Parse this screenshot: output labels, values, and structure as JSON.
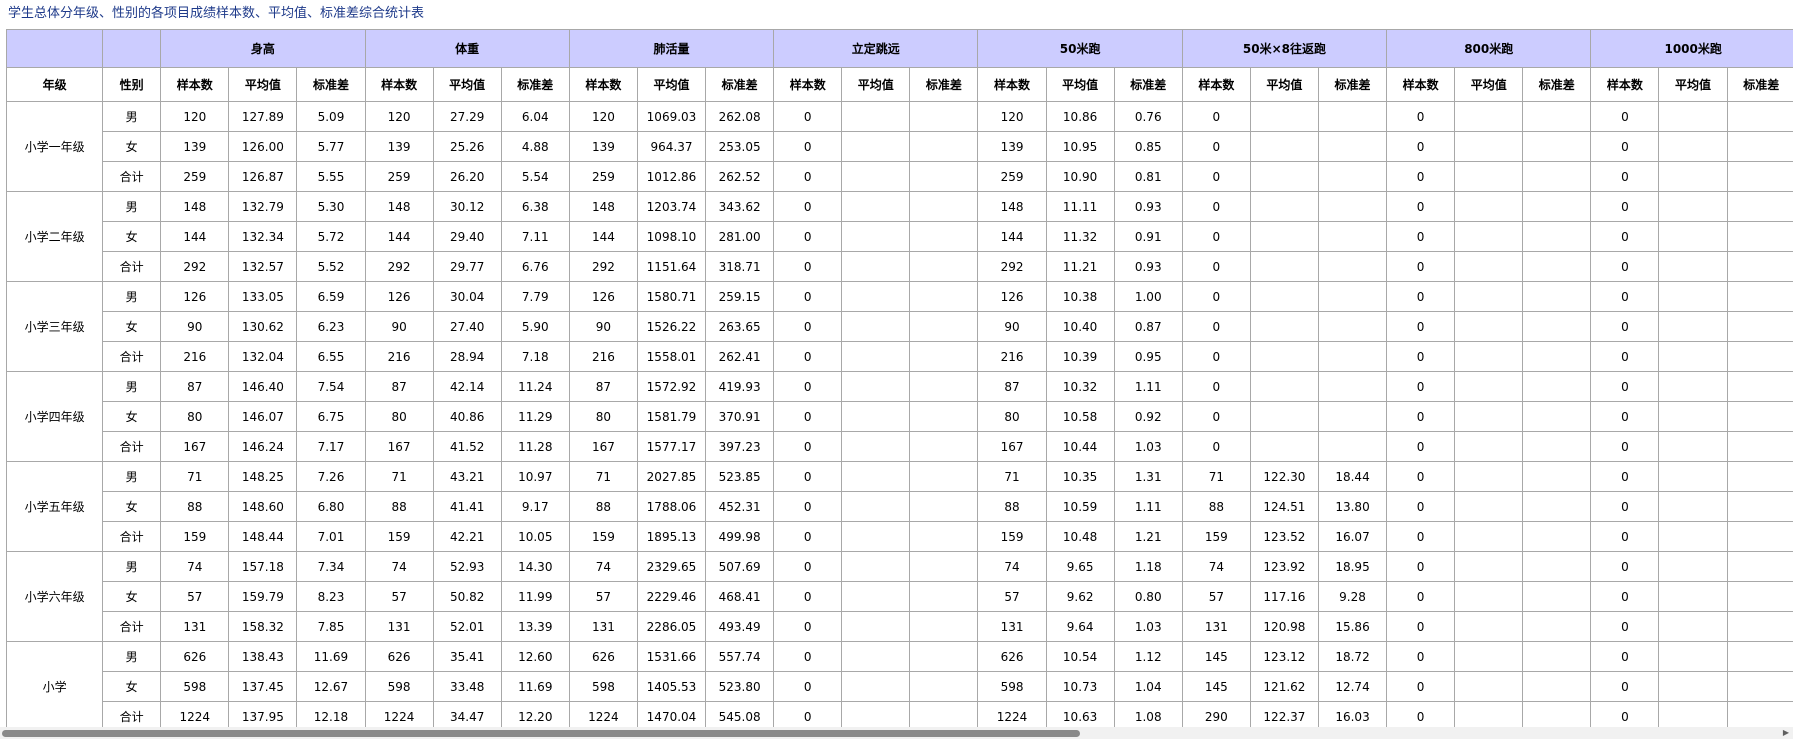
{
  "title": "学生总体分年级、性别的各项目成绩样本数、平均值、标准差综合统计表",
  "headers": {
    "grade": "年级",
    "gender": "性别",
    "sub": [
      "样本数",
      "平均值",
      "标准差"
    ],
    "items": [
      "身高",
      "体重",
      "肺活量",
      "立定跳远",
      "50米跑",
      "50米×8往返跑",
      "800米跑",
      "1000米跑"
    ]
  },
  "rows": [
    {
      "grade": "小学一年级",
      "gender": "男",
      "cells": [
        "120",
        "127.89",
        "5.09",
        "120",
        "27.29",
        "6.04",
        "120",
        "1069.03",
        "262.08",
        "0",
        "",
        "",
        "120",
        "10.86",
        "0.76",
        "0",
        "",
        "",
        "0",
        "",
        "",
        "0",
        "",
        ""
      ]
    },
    {
      "grade": "",
      "gender": "女",
      "cells": [
        "139",
        "126.00",
        "5.77",
        "139",
        "25.26",
        "4.88",
        "139",
        "964.37",
        "253.05",
        "0",
        "",
        "",
        "139",
        "10.95",
        "0.85",
        "0",
        "",
        "",
        "0",
        "",
        "",
        "0",
        "",
        ""
      ]
    },
    {
      "grade": "",
      "gender": "合计",
      "cells": [
        "259",
        "126.87",
        "5.55",
        "259",
        "26.20",
        "5.54",
        "259",
        "1012.86",
        "262.52",
        "0",
        "",
        "",
        "259",
        "10.90",
        "0.81",
        "0",
        "",
        "",
        "0",
        "",
        "",
        "0",
        "",
        ""
      ]
    },
    {
      "grade": "小学二年级",
      "gender": "男",
      "cells": [
        "148",
        "132.79",
        "5.30",
        "148",
        "30.12",
        "6.38",
        "148",
        "1203.74",
        "343.62",
        "0",
        "",
        "",
        "148",
        "11.11",
        "0.93",
        "0",
        "",
        "",
        "0",
        "",
        "",
        "0",
        "",
        ""
      ]
    },
    {
      "grade": "",
      "gender": "女",
      "cells": [
        "144",
        "132.34",
        "5.72",
        "144",
        "29.40",
        "7.11",
        "144",
        "1098.10",
        "281.00",
        "0",
        "",
        "",
        "144",
        "11.32",
        "0.91",
        "0",
        "",
        "",
        "0",
        "",
        "",
        "0",
        "",
        ""
      ]
    },
    {
      "grade": "",
      "gender": "合计",
      "cells": [
        "292",
        "132.57",
        "5.52",
        "292",
        "29.77",
        "6.76",
        "292",
        "1151.64",
        "318.71",
        "0",
        "",
        "",
        "292",
        "11.21",
        "0.93",
        "0",
        "",
        "",
        "0",
        "",
        "",
        "0",
        "",
        ""
      ]
    },
    {
      "grade": "小学三年级",
      "gender": "男",
      "cells": [
        "126",
        "133.05",
        "6.59",
        "126",
        "30.04",
        "7.79",
        "126",
        "1580.71",
        "259.15",
        "0",
        "",
        "",
        "126",
        "10.38",
        "1.00",
        "0",
        "",
        "",
        "0",
        "",
        "",
        "0",
        "",
        ""
      ]
    },
    {
      "grade": "",
      "gender": "女",
      "cells": [
        "90",
        "130.62",
        "6.23",
        "90",
        "27.40",
        "5.90",
        "90",
        "1526.22",
        "263.65",
        "0",
        "",
        "",
        "90",
        "10.40",
        "0.87",
        "0",
        "",
        "",
        "0",
        "",
        "",
        "0",
        "",
        ""
      ]
    },
    {
      "grade": "",
      "gender": "合计",
      "cells": [
        "216",
        "132.04",
        "6.55",
        "216",
        "28.94",
        "7.18",
        "216",
        "1558.01",
        "262.41",
        "0",
        "",
        "",
        "216",
        "10.39",
        "0.95",
        "0",
        "",
        "",
        "0",
        "",
        "",
        "0",
        "",
        ""
      ]
    },
    {
      "grade": "小学四年级",
      "gender": "男",
      "cells": [
        "87",
        "146.40",
        "7.54",
        "87",
        "42.14",
        "11.24",
        "87",
        "1572.92",
        "419.93",
        "0",
        "",
        "",
        "87",
        "10.32",
        "1.11",
        "0",
        "",
        "",
        "0",
        "",
        "",
        "0",
        "",
        ""
      ]
    },
    {
      "grade": "",
      "gender": "女",
      "cells": [
        "80",
        "146.07",
        "6.75",
        "80",
        "40.86",
        "11.29",
        "80",
        "1581.79",
        "370.91",
        "0",
        "",
        "",
        "80",
        "10.58",
        "0.92",
        "0",
        "",
        "",
        "0",
        "",
        "",
        "0",
        "",
        ""
      ]
    },
    {
      "grade": "",
      "gender": "合计",
      "cells": [
        "167",
        "146.24",
        "7.17",
        "167",
        "41.52",
        "11.28",
        "167",
        "1577.17",
        "397.23",
        "0",
        "",
        "",
        "167",
        "10.44",
        "1.03",
        "0",
        "",
        "",
        "0",
        "",
        "",
        "0",
        "",
        ""
      ]
    },
    {
      "grade": "小学五年级",
      "gender": "男",
      "cells": [
        "71",
        "148.25",
        "7.26",
        "71",
        "43.21",
        "10.97",
        "71",
        "2027.85",
        "523.85",
        "0",
        "",
        "",
        "71",
        "10.35",
        "1.31",
        "71",
        "122.30",
        "18.44",
        "0",
        "",
        "",
        "0",
        "",
        ""
      ]
    },
    {
      "grade": "",
      "gender": "女",
      "cells": [
        "88",
        "148.60",
        "6.80",
        "88",
        "41.41",
        "9.17",
        "88",
        "1788.06",
        "452.31",
        "0",
        "",
        "",
        "88",
        "10.59",
        "1.11",
        "88",
        "124.51",
        "13.80",
        "0",
        "",
        "",
        "0",
        "",
        ""
      ]
    },
    {
      "grade": "",
      "gender": "合计",
      "cells": [
        "159",
        "148.44",
        "7.01",
        "159",
        "42.21",
        "10.05",
        "159",
        "1895.13",
        "499.98",
        "0",
        "",
        "",
        "159",
        "10.48",
        "1.21",
        "159",
        "123.52",
        "16.07",
        "0",
        "",
        "",
        "0",
        "",
        ""
      ]
    },
    {
      "grade": "小学六年级",
      "gender": "男",
      "cells": [
        "74",
        "157.18",
        "7.34",
        "74",
        "52.93",
        "14.30",
        "74",
        "2329.65",
        "507.69",
        "0",
        "",
        "",
        "74",
        "9.65",
        "1.18",
        "74",
        "123.92",
        "18.95",
        "0",
        "",
        "",
        "0",
        "",
        ""
      ]
    },
    {
      "grade": "",
      "gender": "女",
      "cells": [
        "57",
        "159.79",
        "8.23",
        "57",
        "50.82",
        "11.99",
        "57",
        "2229.46",
        "468.41",
        "0",
        "",
        "",
        "57",
        "9.62",
        "0.80",
        "57",
        "117.16",
        "9.28",
        "0",
        "",
        "",
        "0",
        "",
        ""
      ]
    },
    {
      "grade": "",
      "gender": "合计",
      "cells": [
        "131",
        "158.32",
        "7.85",
        "131",
        "52.01",
        "13.39",
        "131",
        "2286.05",
        "493.49",
        "0",
        "",
        "",
        "131",
        "9.64",
        "1.03",
        "131",
        "120.98",
        "15.86",
        "0",
        "",
        "",
        "0",
        "",
        ""
      ]
    },
    {
      "grade": "小学",
      "gender": "男",
      "cells": [
        "626",
        "138.43",
        "11.69",
        "626",
        "35.41",
        "12.60",
        "626",
        "1531.66",
        "557.74",
        "0",
        "",
        "",
        "626",
        "10.54",
        "1.12",
        "145",
        "123.12",
        "18.72",
        "0",
        "",
        "",
        "0",
        "",
        ""
      ]
    },
    {
      "grade": "",
      "gender": "女",
      "cells": [
        "598",
        "137.45",
        "12.67",
        "598",
        "33.48",
        "11.69",
        "598",
        "1405.53",
        "523.80",
        "0",
        "",
        "",
        "598",
        "10.73",
        "1.04",
        "145",
        "121.62",
        "12.74",
        "0",
        "",
        "",
        "0",
        "",
        ""
      ]
    },
    {
      "grade": "",
      "gender": "合计",
      "cells": [
        "1224",
        "137.95",
        "12.18",
        "1224",
        "34.47",
        "12.20",
        "1224",
        "1470.04",
        "545.08",
        "0",
        "",
        "",
        "1224",
        "10.63",
        "1.08",
        "290",
        "122.37",
        "16.03",
        "0",
        "",
        "",
        "0",
        "",
        ""
      ]
    }
  ],
  "colors": {
    "header_bg": "#ccccff",
    "title_color": "#1e3a8a",
    "border": "#a8a8a8"
  },
  "icons": {
    "scroll_right": "chevron-right-icon"
  }
}
